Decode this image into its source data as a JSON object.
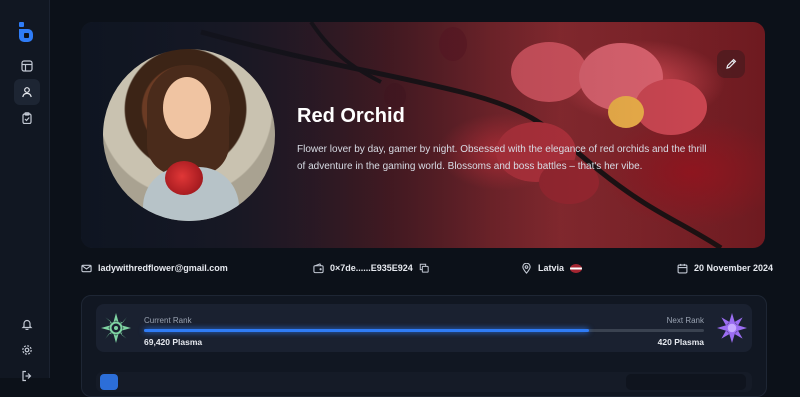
{
  "profile": {
    "name": "Red Orchid",
    "bio": "Flower lover by day, gamer by night. Obsessed with the elegance of red orchids and the thrill of adventure in the gaming world. Blossoms and boss battles – that's her vibe."
  },
  "info": {
    "email": "ladywithredflower@gmail.com",
    "wallet": "0×7de......E935E924",
    "country": "Latvia",
    "date": "20 November 2024"
  },
  "rank": {
    "current_label": "Current Rank",
    "current_value": "69,420 Plasma",
    "next_label": "Next Rank",
    "next_value": "420 Plasma",
    "progress": 0.795
  },
  "colors": {
    "accent": "#2f7cf6",
    "background": "#0c1119",
    "current_rank_badge": "#7fd4a3",
    "next_rank_badge": "#9b6df2"
  },
  "icons": {
    "logo": "app-logo-icon",
    "layout": "layout-icon",
    "user": "user-icon",
    "clipboard": "clipboard-check-icon",
    "bell": "bell-icon",
    "settings": "gear-icon",
    "logout": "logout-icon",
    "edit": "pencil-icon",
    "email": "mail-icon",
    "wallet": "wallet-icon",
    "copy": "copy-icon",
    "location": "map-pin-icon",
    "calendar": "calendar-icon"
  }
}
